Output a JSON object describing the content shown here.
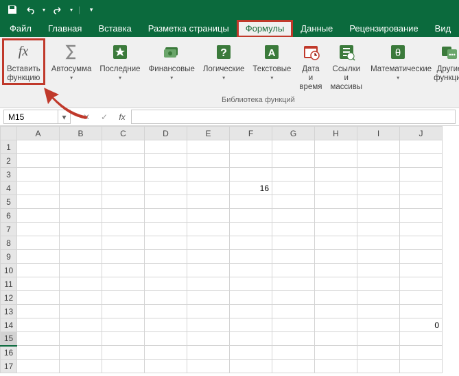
{
  "qat": {
    "save_title": "Сохранить",
    "undo_title": "Отменить",
    "redo_title": "Повторить"
  },
  "tabs": {
    "file": "Файл",
    "home": "Главная",
    "insert": "Вставка",
    "pagelayout": "Разметка страницы",
    "formulas": "Формулы",
    "data": "Данные",
    "review": "Рецензирование",
    "view": "Вид"
  },
  "ribbon": {
    "insert_fn_l1": "Вставить",
    "insert_fn_l2": "функцию",
    "autosum": "Автосумма",
    "recent": "Последние",
    "financial": "Финансовые",
    "logical": "Логические",
    "text": "Текстовые",
    "datetime_l1": "Дата и",
    "datetime_l2": "время",
    "lookup_l1": "Ссылки и",
    "lookup_l2": "массивы",
    "math": "Математические",
    "more_l1": "Другие",
    "more_l2": "функции",
    "group_label": "Библиотека функций",
    "dd": "▾"
  },
  "formula_bar": {
    "name_box": "M15",
    "cancel": "✕",
    "enter": "✓",
    "fx": "fx",
    "value": ""
  },
  "columns": [
    "A",
    "B",
    "C",
    "D",
    "E",
    "F",
    "G",
    "H",
    "I",
    "J"
  ],
  "row_count": 17,
  "active": {
    "row": 15,
    "col": "M"
  },
  "cells": {
    "F4": "16",
    "J14": "0"
  }
}
